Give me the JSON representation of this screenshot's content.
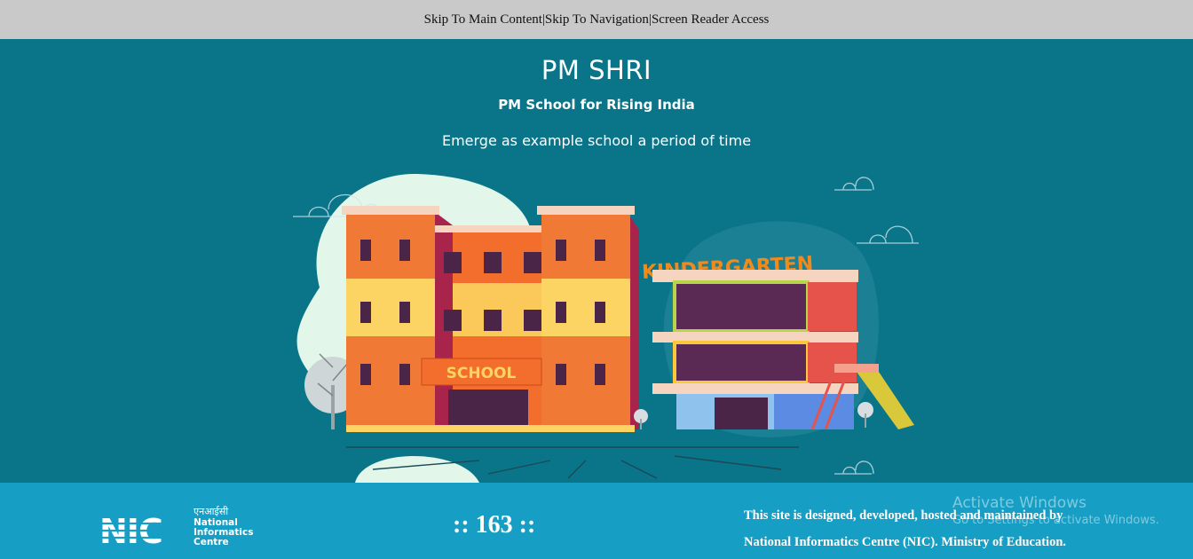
{
  "skip_links": {
    "main": "Skip To Main Content",
    "nav": "Skip To Navigation",
    "reader": "Screen Reader Access",
    "separator": "|"
  },
  "hero": {
    "title": "PM SHRI",
    "subtitle": "PM School for Rising India",
    "tagline": "Emerge as example school a period of time",
    "school_sign": "SCHOOL",
    "kindergarten_sign": "KINDERGARTEN"
  },
  "footer": {
    "logo": {
      "hindi": "एनआईसी",
      "line1": "National",
      "line2": "Informatics",
      "line3": "Centre",
      "mark": "NIC"
    },
    "counter": ":: 163 ::",
    "credit_line1": "This site is designed, developed, hosted and maintained by",
    "credit_line2": "National Informatics Centre (NIC). Ministry of Education.",
    "watermark_title": "Activate Windows",
    "watermark_sub": "Go to Settings to activate Windows."
  },
  "colors": {
    "skipbar": "#c9c9c9",
    "hero_bg": "#0a7488",
    "footer_bg": "#169ec4"
  }
}
